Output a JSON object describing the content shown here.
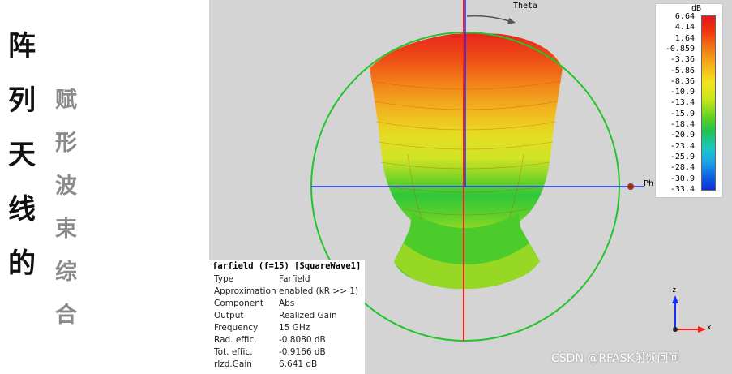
{
  "left_title": {
    "bold_chars": [
      "阵",
      "列",
      "天",
      "线",
      "的"
    ],
    "light_chars": [
      "赋",
      "形",
      "波",
      "束",
      "综",
      "合"
    ]
  },
  "viewport": {
    "theta_label": "Theta",
    "phi_label": "Ph",
    "colors": {
      "background": "#d4d4d4",
      "circle": "#22c42a",
      "z_axis": "#ff1a1a",
      "y_axis": "#1a2cff",
      "x_axis": "#1a2cff"
    }
  },
  "colorbar": {
    "unit": "dB",
    "ticks": [
      "6.64",
      "4.14",
      "1.64",
      "-0.859",
      "-3.36",
      "-5.86",
      "-8.36",
      "-10.9",
      "-13.4",
      "-15.9",
      "-18.4",
      "-20.9",
      "-23.4",
      "-25.9",
      "-28.4",
      "-30.9",
      "-33.4"
    ]
  },
  "info": {
    "title": "farfield (f=15) [SquareWave1]",
    "rows": [
      {
        "key": "Type",
        "value": "Farfield"
      },
      {
        "key": "Approximation",
        "value": "enabled (kR >> 1)"
      },
      {
        "key": "Component",
        "value": "Abs"
      },
      {
        "key": "Output",
        "value": "Realized Gain"
      },
      {
        "key": "Frequency",
        "value": "15 GHz"
      },
      {
        "key": "Rad. effic.",
        "value": "-0.8080 dB"
      },
      {
        "key": "Tot. effic.",
        "value": "-0.9166 dB"
      },
      {
        "key": "rlzd.Gain",
        "value": "6.641 dB"
      }
    ]
  },
  "triad": {
    "z_label": "z",
    "x_label": "x"
  },
  "watermark": "CSDN @RFASK射频问问"
}
